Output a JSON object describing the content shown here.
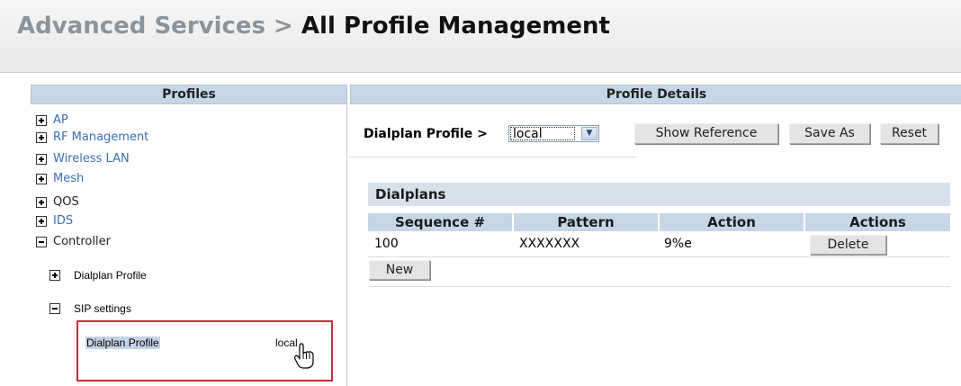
{
  "header": {
    "crumb": "Advanced Services >",
    "current": "All Profile Management"
  },
  "left": {
    "header": "Profiles",
    "tree": [
      {
        "label": "AP",
        "toggle": "plus"
      },
      {
        "label": "RF Management",
        "toggle": "plus"
      },
      {
        "label": "Wireless LAN",
        "toggle": "plus"
      },
      {
        "label": "Mesh",
        "toggle": "plus"
      },
      {
        "label": "QOS",
        "toggle": "plus"
      },
      {
        "label": "IDS",
        "toggle": "plus"
      },
      {
        "label": "Controller",
        "toggle": "minus"
      },
      {
        "label": "Dialplan Profile",
        "toggle": "plus"
      },
      {
        "label": "SIP settings",
        "toggle": "minus"
      }
    ],
    "selected": {
      "name": "Dialplan Profile",
      "value": "local"
    }
  },
  "details": {
    "header": "Profile Details",
    "profile_label": "Dialplan Profile >",
    "profile_select": "local",
    "buttons": {
      "show_reference": "Show Reference",
      "save_as": "Save As",
      "reset": "Reset"
    },
    "section_title": "Dialplans",
    "columns": [
      "Sequence #",
      "Pattern",
      "Action",
      "Actions"
    ],
    "rows": [
      {
        "sequence": "100",
        "pattern": "XXXXXXX",
        "action": "9%e",
        "button": "Delete"
      }
    ],
    "new_button": "New"
  },
  "icons": {
    "expand": "plus-box-icon",
    "collapse": "minus-box-icon",
    "cursor": "hand-pointer-icon",
    "dropdown": "chevron-down-icon"
  },
  "colors": {
    "accent": "#3a6fb4",
    "highlight": "#c0303a",
    "header_bg": "#c6d6e6"
  }
}
